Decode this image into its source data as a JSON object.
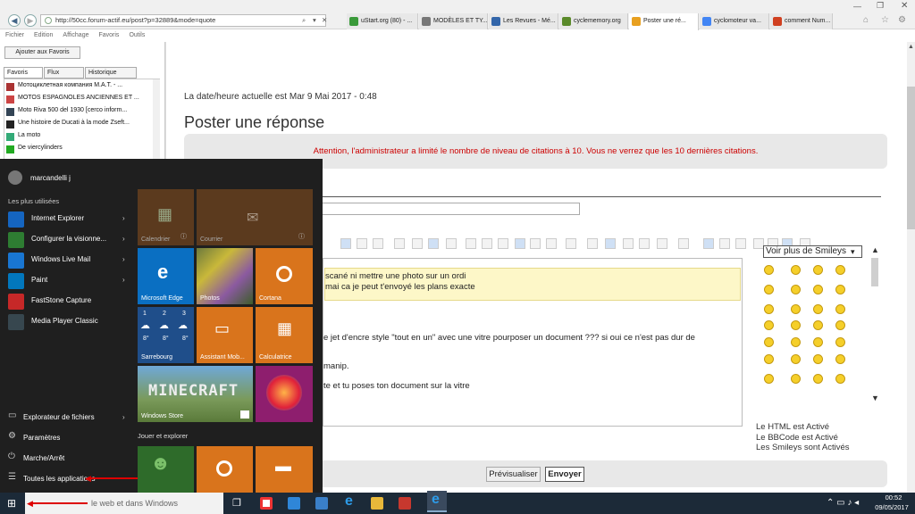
{
  "browser": {
    "url": "http://50cc.forum-actif.eu/post?p=32889&mode=quote",
    "tabs": [
      {
        "label": "uStart.org (80) - ...",
        "color": "#3a9a3a"
      },
      {
        "label": "MODÈLES ET TY...",
        "color": "#777"
      },
      {
        "label": "Les Revues - Mé...",
        "color": "#3366aa"
      },
      {
        "label": "cyclememory.org",
        "color": "#5a8a2a"
      },
      {
        "label": "Poster une ré...",
        "color": "#e8a020"
      },
      {
        "label": "cyclomoteur va...",
        "color": "#4285f4"
      },
      {
        "label": "comment Num...",
        "color": "#d04020"
      }
    ],
    "menu": [
      "Fichier",
      "Edition",
      "Affichage",
      "Favoris",
      "Outils"
    ]
  },
  "favorites": {
    "add_button": "Ajouter aux Favoris",
    "tabs": [
      "Favoris",
      "Flux",
      "Historique"
    ],
    "items": [
      "Мотоциклетная компания М.А.Т. - ...",
      "MOTOS ESPAGNOLES ANCIENNES ET ...",
      "Moto Riva 500 del 1930 [cerco inform...",
      "Une histoire de Ducati à la mode Zseft...",
      "La moto",
      "De viercylinders"
    ]
  },
  "forum": {
    "datetime": "La date/heure actuelle est Mar 9 Mai 2017 - 0:48",
    "heading": "Poster une réponse",
    "warning": "Attention, l'administrateur a limité le nombre de niveau de citations à 10. Vous ne verrez que les 10 dernières citations.",
    "quote_line1": "scané ni mettre une photo sur un ordi",
    "quote_line2": "mai ca je peut t'envoyé les plans exacte",
    "body_line1": "e jet d'encre style \"tout en un\" avec une vitre pourposer un document ???  si oui ce n'est pas dur de",
    "body_line2": "manip.",
    "body_line3": "te et tu poses ton document sur la vitre",
    "smileys_select": "Voir plus de Smileys",
    "html_status": "Le HTML est Activé",
    "bbcode_status": "Le BBCode est Activé",
    "smileys_status": "Les Smileys sont Activés",
    "preview_button": "Prévisualiser",
    "send_button": "Envoyer"
  },
  "start_menu": {
    "user": "marcandelli j",
    "most_used_label": "Les plus utilisées",
    "apps": [
      "Internet Explorer",
      "Configurer la visionne...",
      "Windows Live Mail",
      "Paint",
      "FastStone Capture",
      "Media Player Classic"
    ],
    "bottom": [
      "Explorateur de fichiers",
      "Paramètres",
      "Marche/Arrêt",
      "Toutes les applications"
    ],
    "tiles": {
      "calendar": "Calendrier",
      "mail": "Courrier",
      "edge": "Microsoft Edge",
      "photos": "Photos",
      "cortana": "Cortana",
      "weather_city": "Sarrebourg",
      "weather_days": [
        "1",
        "2",
        "3"
      ],
      "weather_temps": [
        "8°",
        "8°",
        "8°"
      ],
      "assistant": "Assistant Mob...",
      "calc": "Calculatrice",
      "store": "Windows Store",
      "play_label": "Jouer et explorer"
    }
  },
  "taskbar": {
    "search_placeholder": "le web et dans Windows",
    "time": "00:52",
    "date": "09/05/2017"
  }
}
